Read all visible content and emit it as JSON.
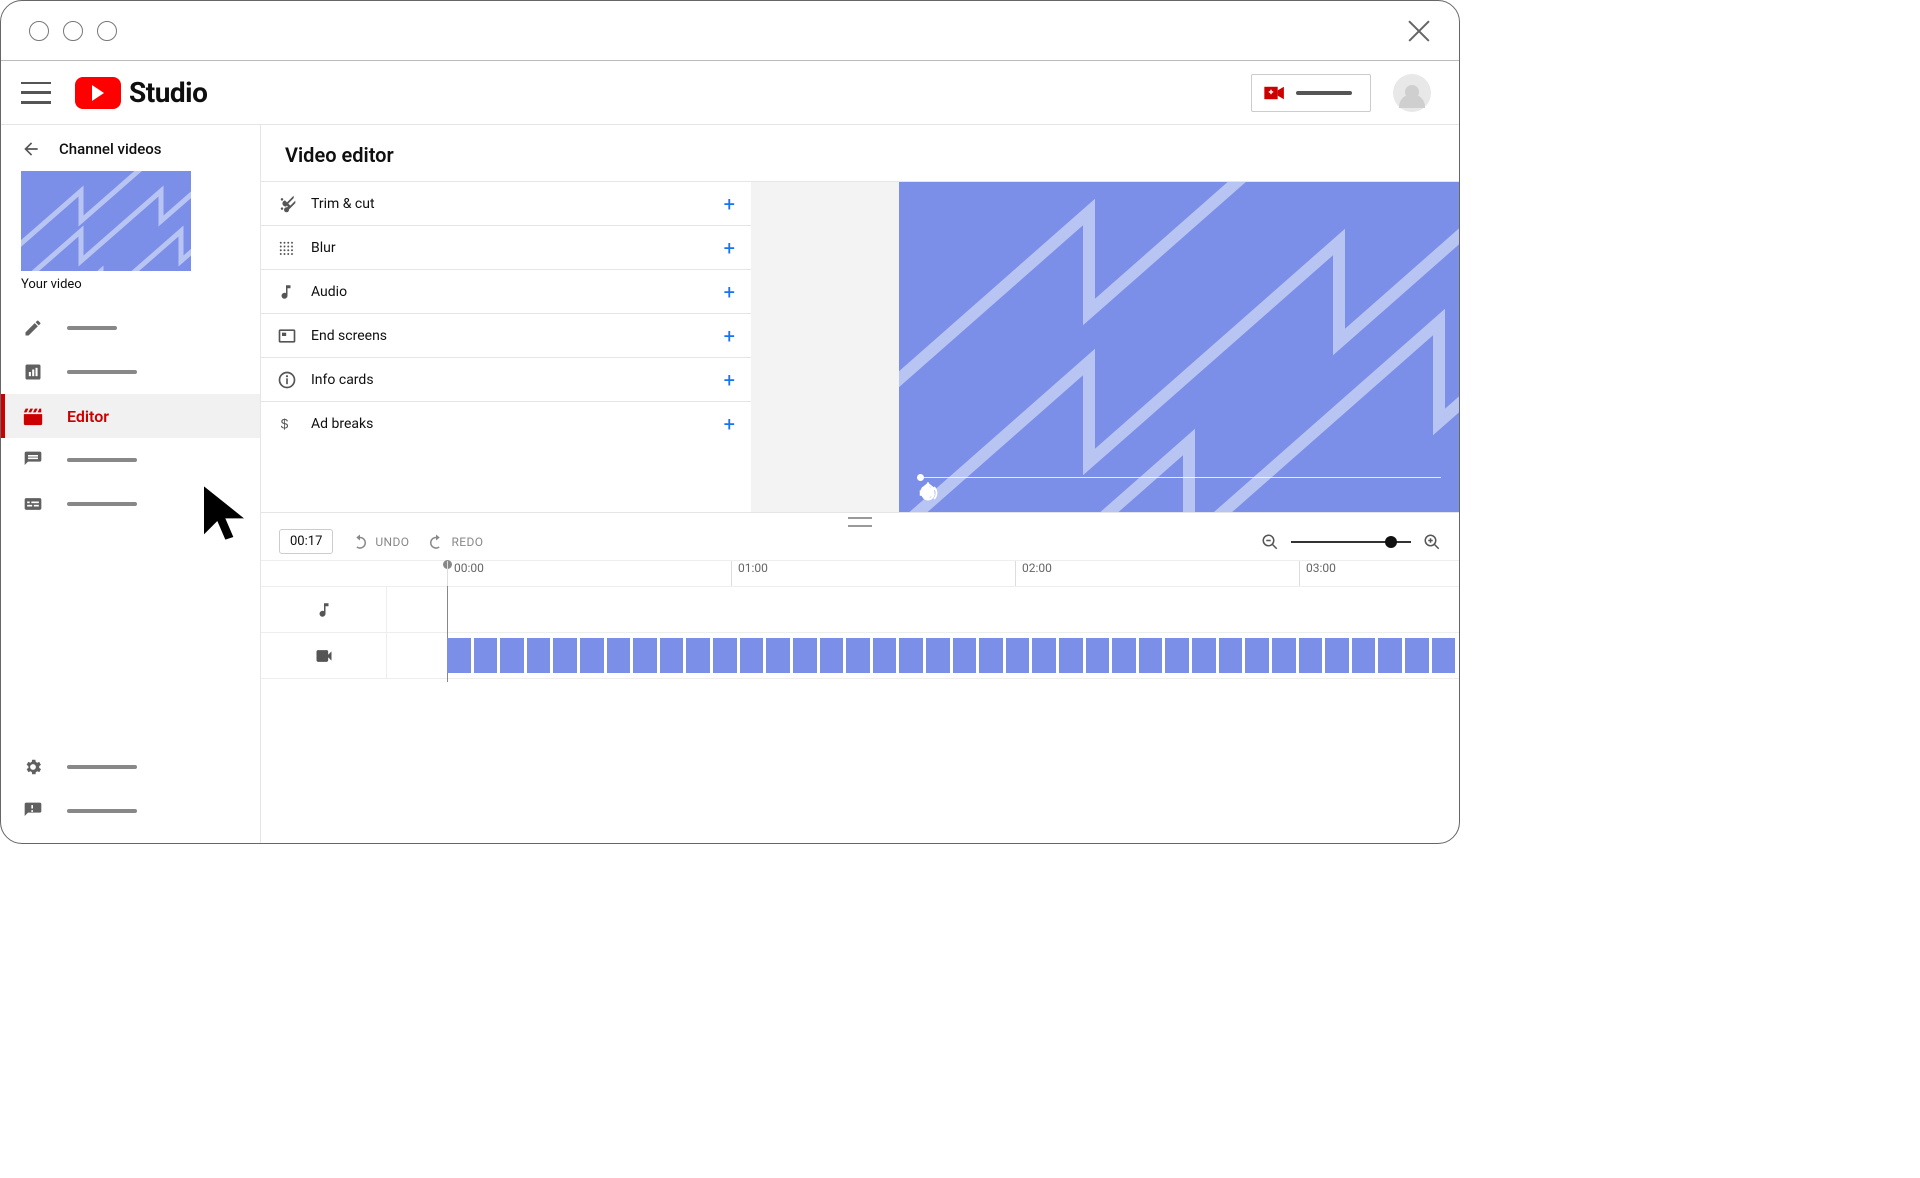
{
  "brand": {
    "text": "Studio"
  },
  "sidebar": {
    "back_label": "Channel videos",
    "your_video_label": "Your video",
    "items": [
      {
        "icon": "pencil"
      },
      {
        "icon": "analytics"
      },
      {
        "icon": "editor",
        "label": "Editor",
        "selected": true
      },
      {
        "icon": "comments"
      },
      {
        "icon": "subtitles"
      }
    ],
    "bottom_items": [
      {
        "icon": "gear"
      },
      {
        "icon": "feedback"
      }
    ]
  },
  "page_title": "Video editor",
  "tools": [
    {
      "icon": "cut",
      "label": "Trim & cut"
    },
    {
      "icon": "grid",
      "label": "Blur"
    },
    {
      "icon": "note",
      "label": "Audio"
    },
    {
      "icon": "endscreen",
      "label": "End screens"
    },
    {
      "icon": "info",
      "label": "Info cards"
    },
    {
      "icon": "dollar",
      "label": "Ad breaks"
    }
  ],
  "player": {
    "controls": [
      "play",
      "replay10",
      "forward10",
      "volume"
    ],
    "right_controls": [
      "settings"
    ]
  },
  "timeline": {
    "current_time": "00:17",
    "undo_label": "UNDO",
    "redo_label": "REDO",
    "ruler_ticks": [
      "00:00",
      "01:00",
      "02:00",
      "03:00"
    ],
    "tracks": [
      {
        "icon": "note",
        "kind": "audio",
        "has_clips": false
      },
      {
        "icon": "video",
        "kind": "video",
        "has_clips": true,
        "clip_count": 38
      }
    ]
  }
}
